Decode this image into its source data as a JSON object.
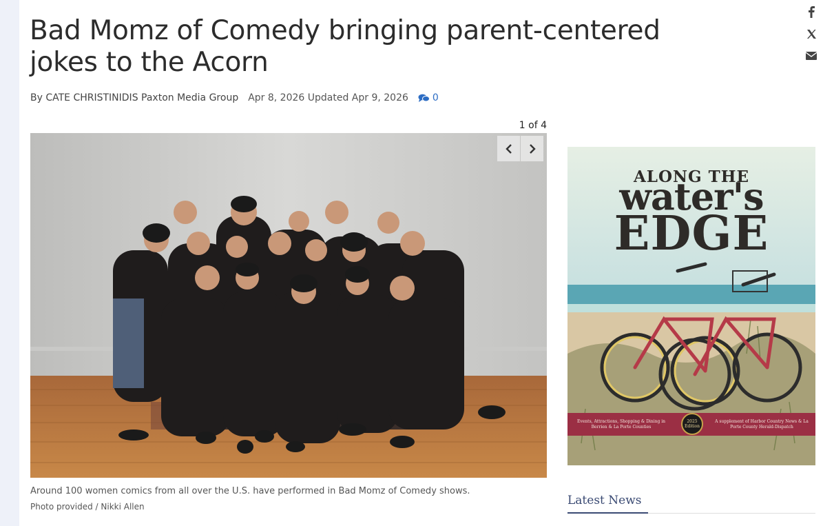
{
  "article": {
    "headline": "Bad Momz of Comedy bringing parent-centered jokes to the Acorn",
    "byline": "By CATE CHRISTINIDIS Paxton Media Group",
    "dates": "Apr 8, 2026 Updated Apr 9, 2026",
    "comment_count": "0"
  },
  "share": {
    "icons": [
      "facebook-icon",
      "x-icon",
      "email-icon"
    ]
  },
  "gallery": {
    "counter": "1 of 4",
    "caption": "Around 100 women comics from all over the U.S. have performed in Bad Momz of Comedy shows.",
    "credit": "Photo provided / Nikki Allen"
  },
  "ad": {
    "line1": "ALONG THE",
    "line2": "water's",
    "line3": "EDGE",
    "band_left": "Events, Attractions, Shopping & Dining in Berrien & La Porte Counties",
    "badge": "2025 Edition",
    "band_right": "A supplement of Harbor Country News & La Porte County Herald-Dispatch"
  },
  "sidebar": {
    "latest_news": "Latest News"
  },
  "colors": {
    "link_blue": "#2d6dc4",
    "ad_band": "#9b2f44",
    "latest_news": "#3a4a73"
  }
}
